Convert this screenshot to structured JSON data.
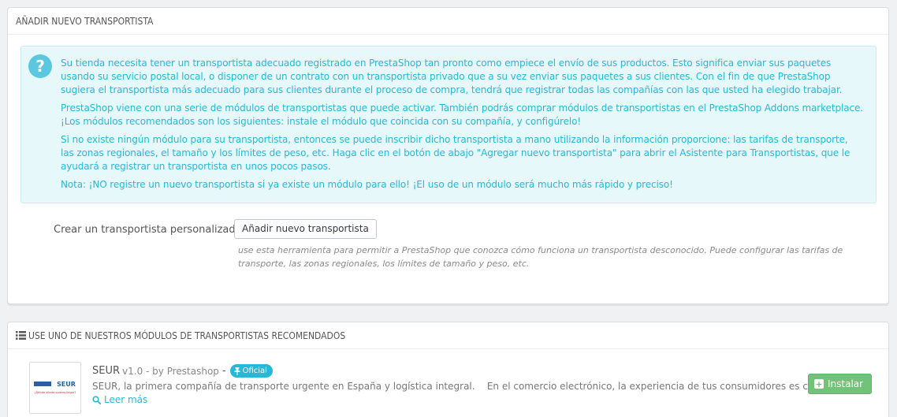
{
  "panel1": {
    "heading": "AÑADIR NUEVO TRANSPORTISTA",
    "alert": {
      "icon": "question-circle-icon",
      "paragraphs": [
        "Su tienda necesita tener un transportista adecuado registrado en PrestaShop tan pronto como empiece el envío de sus productos. Esto significa enviar sus paquetes usando su servicio postal local, o disponer de un contrato con un transportista privado que a su vez enviar sus paquetes a sus clientes. Con el fin de que PrestaShop sugiera el transportista más adecuado para sus clientes durante el proceso de compra, tendrá que registrar todas las compañías con las que usted ha elegido trabajar.",
        "PrestaShop viene con una serie de módulos de transportistas que puede activar. También podrás comprar módulos de transportistas en el PrestaShop Addons marketplace. ¡Los módulos recomendados son los siguientes: instale el módulo que coincida con su compañía, y configúrelo!",
        "Si no existe ningún módulo para su transportista, entonces se puede inscribir dicho transportista a mano utilizando la información proporcione: las tarifas de transporte, las zonas regionales, el tamaño y los límites de peso, etc. Haga clic en el botón de abajo \"Agregar nuevo transportista\" para abrir el Asistente para Transportistas, que le ayudará a registrar un transportista en unos pocos pasos.",
        "Nota: ¡NO registre un nuevo transportista si ya existe un módulo para ello! ¡El uso de un módulo será mucho más rápido y preciso!"
      ]
    },
    "form": {
      "label": "Crear un transportista personalizado",
      "button": "Añadir nuevo transportista",
      "help": "use esta herramienta para permitir a PrestaShop que conozca cómo funciona un transportista desconocido. Puede configurar las tarifas de transporte, las zonas regionales, los límites de tamaño y peso, etc."
    }
  },
  "panel2": {
    "heading_icon": "list-icon",
    "heading": "USE UNO DE NUESTROS MÓDULOS DE TRANSPORTISTAS RECOMENDADOS",
    "module": {
      "name": "SEUR",
      "version": "v1.0 - by Prestashop",
      "separator": "-",
      "badge": "Oficial",
      "badge_icon": "pin-icon",
      "logo_text": "SEUR",
      "logo_tagline": "¿Dónde dónde quieres llegar?",
      "description": "SEUR, la primera compañía de transporte urgente en España y logística integral.    En el comercio electrónico, la experiencia de tus consumidores es clave",
      "link": "Leer más",
      "link_icon": "search-icon",
      "install_button": "Instalar",
      "install_icon": "plus-square-icon"
    }
  },
  "colors": {
    "info": "#25b9d7",
    "info_bg": "#e7f8fb",
    "success": "#72c279",
    "background": "#eff1f2"
  }
}
